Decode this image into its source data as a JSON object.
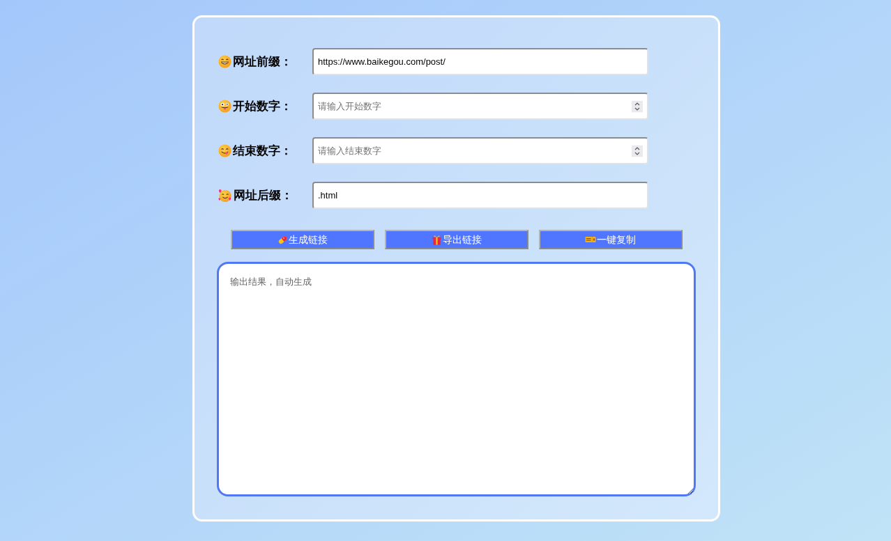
{
  "form": {
    "fields": [
      {
        "label": "网址前缀：",
        "kind": "text",
        "value": "https://www.baikegou.com/post/"
      },
      {
        "label": "开始数字：",
        "kind": "number",
        "placeholder": "请输入开始数字"
      },
      {
        "label": "结束数字：",
        "kind": "number",
        "placeholder": "请输入结束数字"
      },
      {
        "label": "网址后缀：",
        "kind": "text",
        "value": ".html"
      }
    ]
  },
  "buttons": [
    {
      "label": "生成链接"
    },
    {
      "label": "导出链接"
    },
    {
      "label": "一键复制"
    }
  ],
  "output": {
    "placeholder": "输出结果，自动生成"
  }
}
